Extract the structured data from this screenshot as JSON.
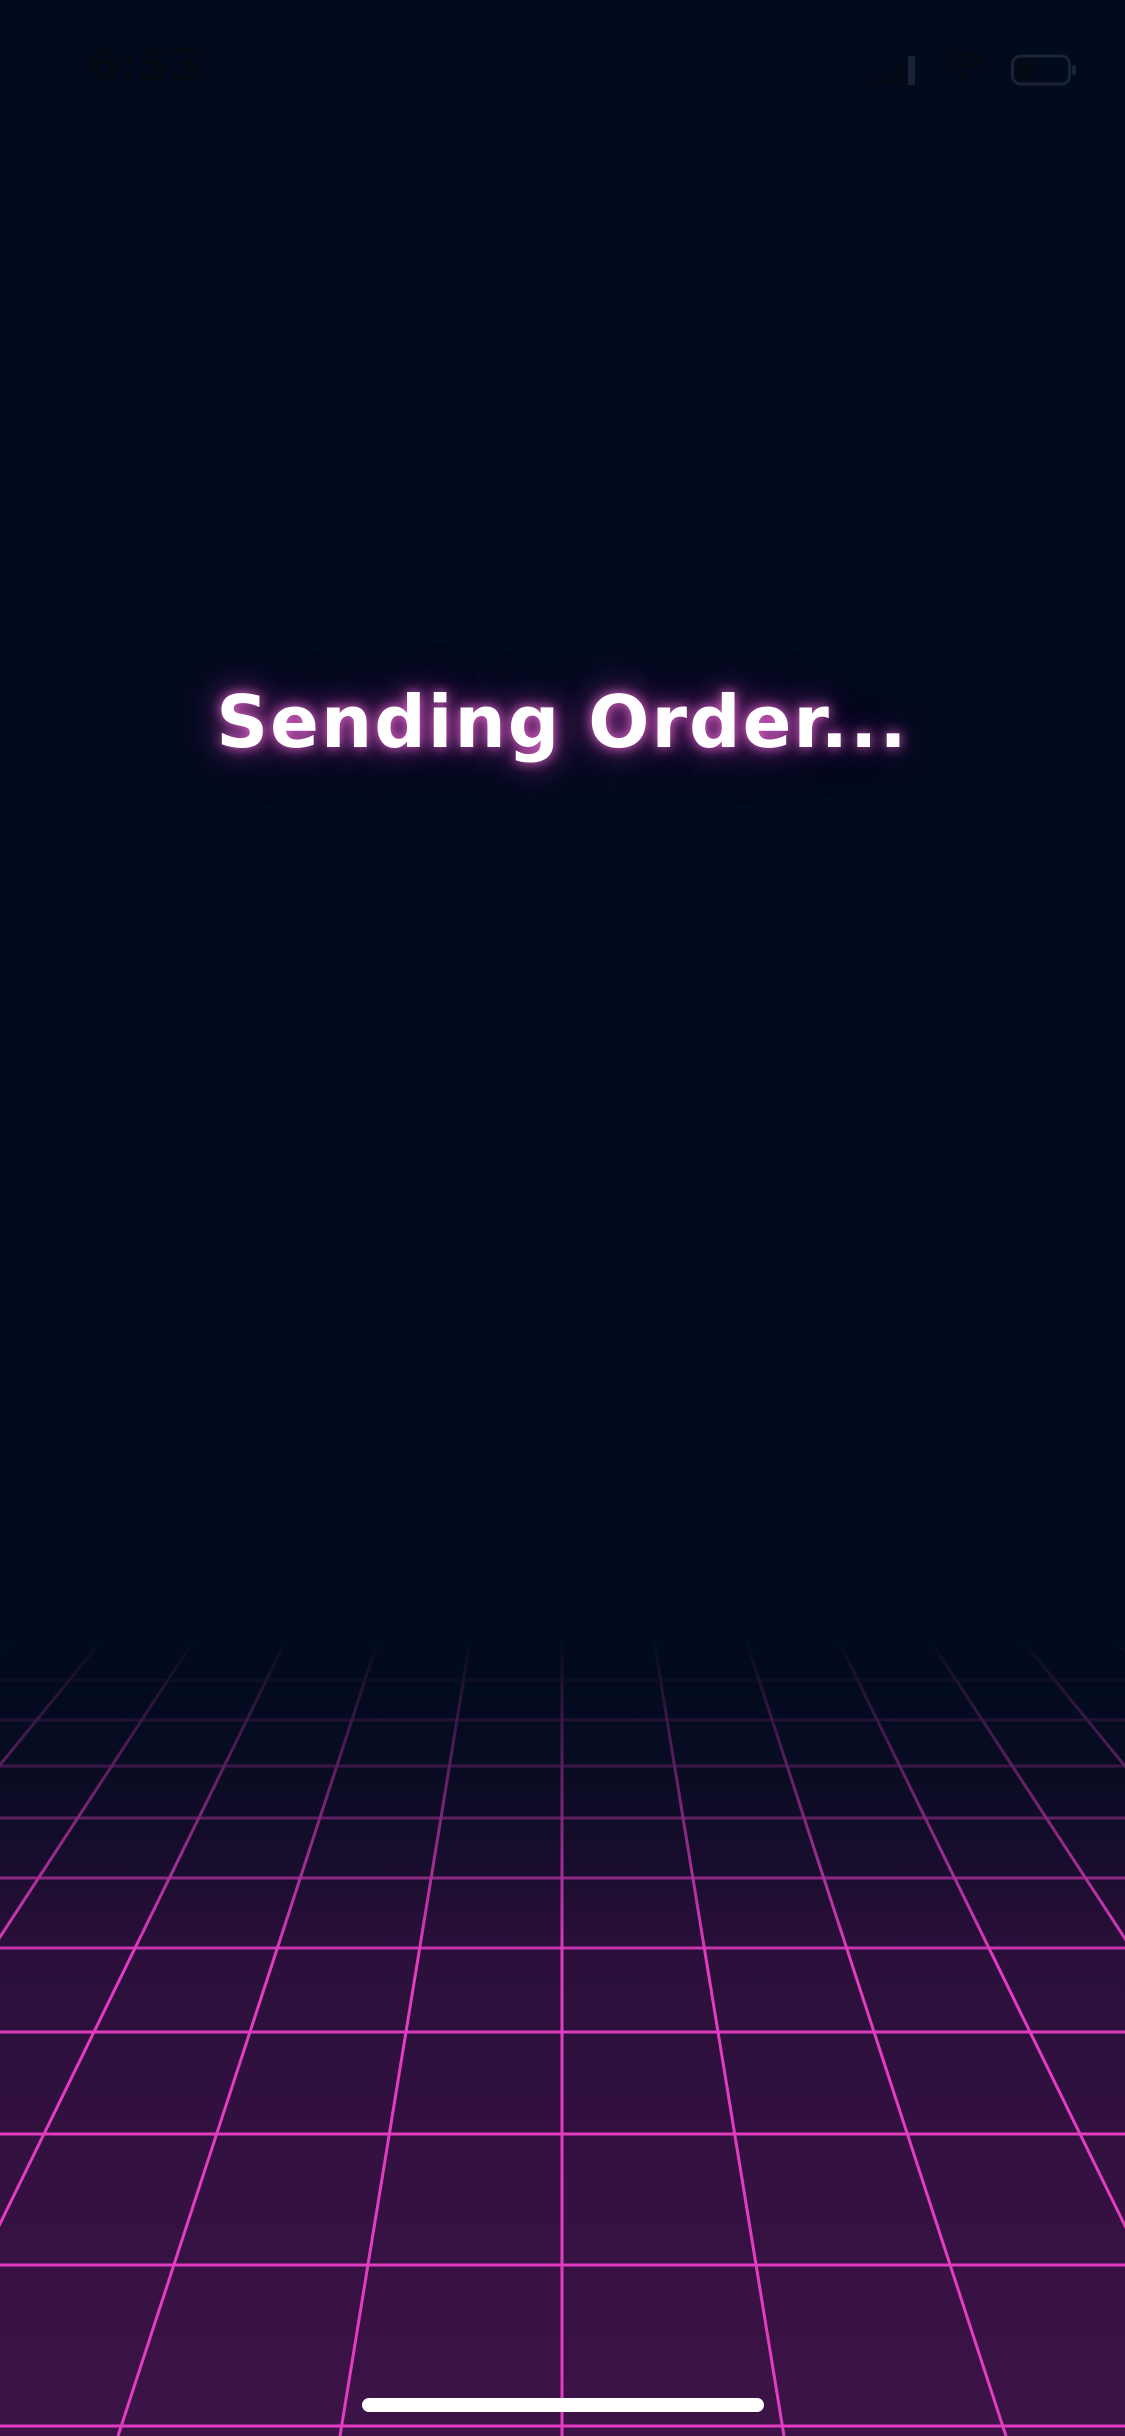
{
  "status_bar": {
    "time": "6:53",
    "icons": [
      "cellular-signal-icon",
      "wifi-icon",
      "battery-icon"
    ]
  },
  "main": {
    "message": "Sending Order..."
  },
  "theme": {
    "background": "#020b1e",
    "grid_line_color": "#e23cc1",
    "grid_fill_color": "#3a1245",
    "glow_color": "#e646c8"
  }
}
